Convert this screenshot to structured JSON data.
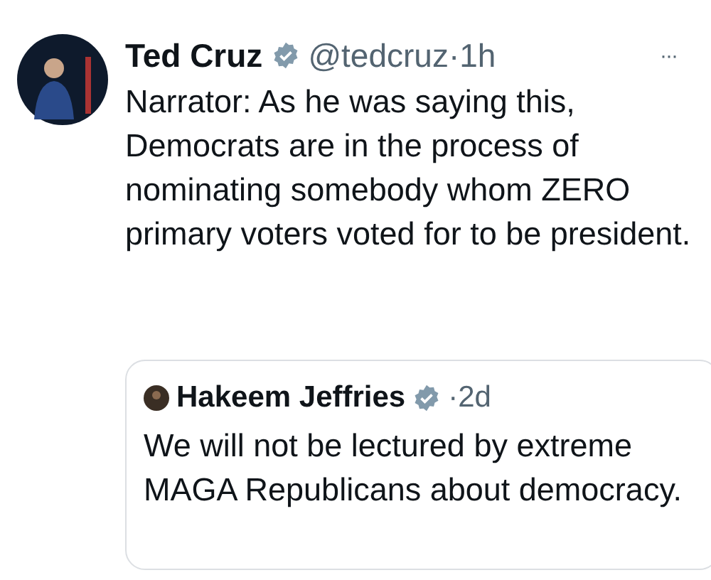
{
  "post": {
    "author": "Ted Cruz",
    "verified": true,
    "handle": "@tedcruz",
    "separator": "·",
    "time": "1h",
    "more": "···",
    "text": "Narrator: As he was saying this, Democrats are in the process of nominating somebody whom ZERO primary voters voted for to be president.",
    "quote": {
      "author": "Hakeem Jeffries",
      "verified": true,
      "separator": "·",
      "time": "2d",
      "text": "We will not be lectured by extreme MAGA Republicans about democracy."
    }
  }
}
